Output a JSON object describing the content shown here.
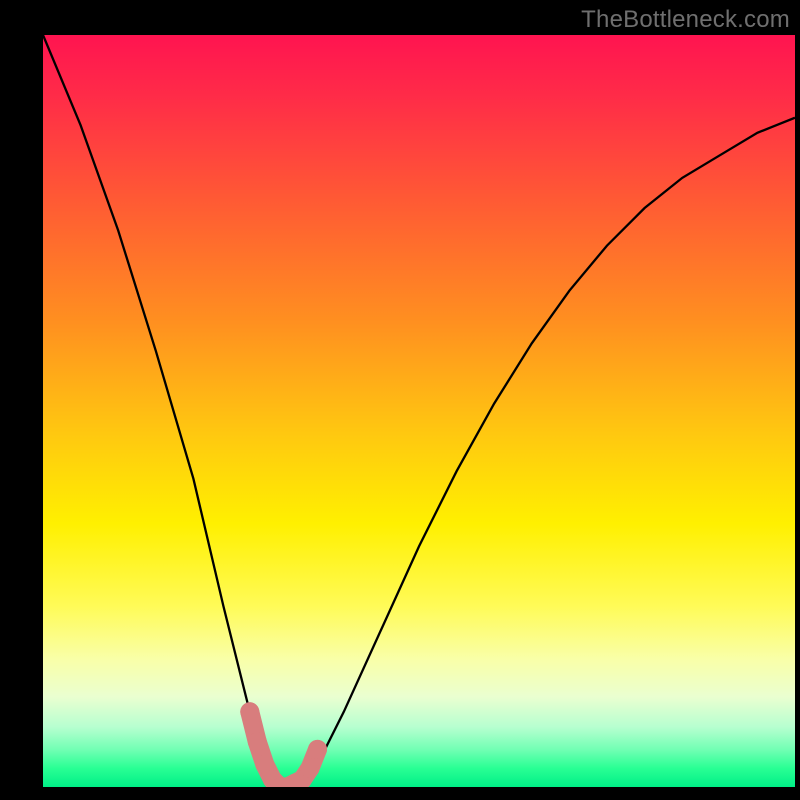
{
  "watermark": "TheBottleneck.com",
  "chart_data": {
    "type": "line",
    "title": "",
    "xlabel": "",
    "ylabel": "",
    "xlim": [
      0,
      100
    ],
    "ylim": [
      0,
      100
    ],
    "series": [
      {
        "name": "bottleneck-curve",
        "x": [
          0,
          5,
          10,
          15,
          20,
          24,
          27,
          29,
          30,
          31,
          32,
          33,
          34,
          35,
          37,
          40,
          45,
          50,
          55,
          60,
          65,
          70,
          75,
          80,
          85,
          90,
          95,
          100
        ],
        "values": [
          100,
          88,
          74,
          58,
          41,
          24,
          12,
          4,
          1,
          0,
          0,
          0,
          0,
          1,
          4,
          10,
          21,
          32,
          42,
          51,
          59,
          66,
          72,
          77,
          81,
          84,
          87,
          89
        ]
      }
    ],
    "annotations": [
      {
        "name": "optimal-region-markers",
        "type": "marker-band",
        "color": "#d87d7d",
        "x": [
          27.5,
          28.5,
          29.5,
          30.5,
          31.5,
          32.5,
          33.5,
          34.5,
          35.5,
          36.5
        ],
        "values": [
          10,
          6,
          3,
          1,
          0,
          0,
          0.5,
          1,
          2.5,
          5
        ]
      }
    ],
    "background_gradient_meaning": "color scale from green (0, no bottleneck) to red (100, full bottleneck)"
  },
  "colors": {
    "frame": "#000000",
    "curve": "#000000",
    "markers": "#d87d7d",
    "watermark": "#6f6f6f"
  }
}
